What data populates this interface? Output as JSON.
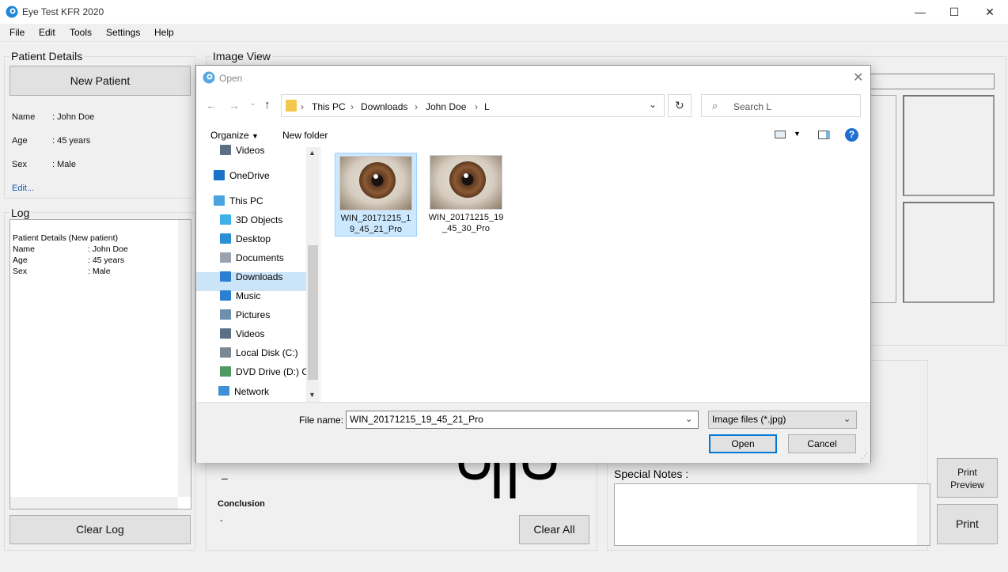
{
  "window": {
    "title": "Eye Test KFR 2020",
    "controls": {
      "minimize": "—",
      "maximize": "☐",
      "close": "✕"
    }
  },
  "menu": [
    "File",
    "Edit",
    "Tools",
    "Settings",
    "Help"
  ],
  "patient_details": {
    "title": "Patient Details",
    "new_patient_label": "New Patient",
    "fields": [
      {
        "label": "Name",
        "value": ": John Doe"
      },
      {
        "label": "Age",
        "value": ": 45 years"
      },
      {
        "label": "Sex",
        "value": ": Male"
      }
    ],
    "edit_link": "Edit..."
  },
  "log": {
    "title": "Log",
    "heading": "Patient Details (New patient)",
    "lines": [
      {
        "label": "Name",
        "value": ": John Doe"
      },
      {
        "label": "Age",
        "value": ": 45 years"
      },
      {
        "label": "Sex",
        "value": ": Male"
      }
    ],
    "clear_label": "Clear Log"
  },
  "image_view": {
    "title": "Image View"
  },
  "result": {
    "dash": "–",
    "conclusion_label": "Conclusion",
    "conclusion_value": "-",
    "clear_all_label": "Clear All"
  },
  "special_notes": {
    "label": "Special Notes :"
  },
  "print": {
    "preview_line1": "Print",
    "preview_line2": "Preview",
    "print_label": "Print"
  },
  "dialog": {
    "title": "Open",
    "breadcrumb": [
      "This PC",
      "Downloads",
      "John Doe",
      "L"
    ],
    "search_placeholder": "Search L",
    "toolbar": {
      "organize": "Organize",
      "new_folder": "New folder"
    },
    "nav_items": [
      {
        "label": "Videos",
        "icon": "video-folder-icon",
        "color": "#5b6f86"
      },
      {
        "label": "OneDrive",
        "icon": "cloud-icon",
        "color": "#1a73c8"
      },
      {
        "label": "This PC",
        "icon": "computer-icon",
        "color": "#4aa3df"
      },
      {
        "label": "3D Objects",
        "icon": "cube-icon",
        "color": "#3fb0e8"
      },
      {
        "label": "Desktop",
        "icon": "desktop-icon",
        "color": "#2b8fd6"
      },
      {
        "label": "Documents",
        "icon": "documents-icon",
        "color": "#9aa3ad"
      },
      {
        "label": "Downloads",
        "icon": "download-icon",
        "color": "#2b7fd0"
      },
      {
        "label": "Music",
        "icon": "music-icon",
        "color": "#2b7fd0"
      },
      {
        "label": "Pictures",
        "icon": "pictures-icon",
        "color": "#6d8fb0"
      },
      {
        "label": "Videos",
        "icon": "video-folder-icon",
        "color": "#5b6f86"
      },
      {
        "label": "Local Disk (C:)",
        "icon": "disk-icon",
        "color": "#7a8894"
      },
      {
        "label": "DVD Drive (D:) C",
        "icon": "dvd-icon",
        "color": "#4f9a63"
      },
      {
        "label": "Network",
        "icon": "network-icon",
        "color": "#3f8fd6"
      }
    ],
    "selected_nav": "Downloads",
    "files": [
      {
        "name": "WIN_20171215_19_45_21_Pro",
        "selected": true
      },
      {
        "name": "WIN_20171215_19_45_30_Pro",
        "selected": false
      }
    ],
    "file_name_label": "File name:",
    "file_name_value": "WIN_20171215_19_45_21_Pro",
    "file_type_value": "Image files (*.jpg)",
    "open_label": "Open",
    "cancel_label": "Cancel"
  }
}
